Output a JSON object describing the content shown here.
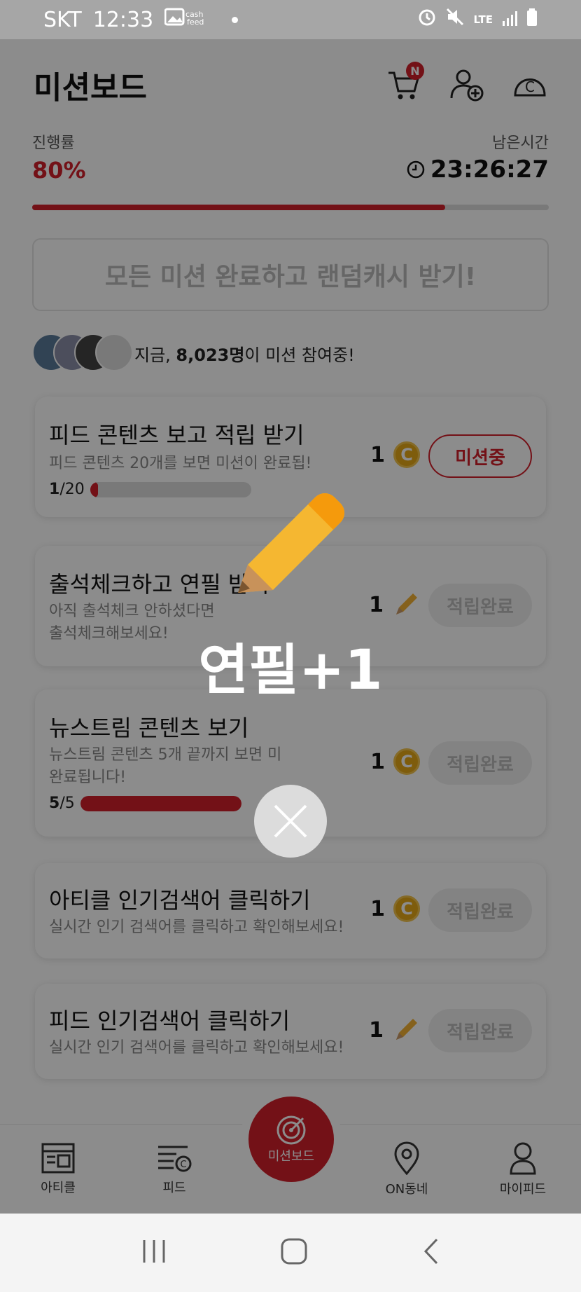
{
  "status_bar": {
    "carrier": "SKT",
    "time": "12:33",
    "network": "LTE"
  },
  "header": {
    "title": "미션보드",
    "cart_badge": "N"
  },
  "progress": {
    "label": "진행률",
    "value_text": "80%",
    "value": 0.8,
    "remaining_label": "남은시간",
    "remaining_time": "23:26:27"
  },
  "all_missions_button": "모든 미션 완료하고 랜덤캐시 받기!",
  "participants": {
    "prefix": "지금, ",
    "count": "8,023명",
    "suffix": "이 미션 참여중!"
  },
  "missions": [
    {
      "title": "피드 콘텐츠 보고 적립 받기",
      "desc": "피드 콘텐츠 20개를 보면 미션이 완료됩!",
      "reward": "1",
      "reward_type": "coin",
      "status": "미션중",
      "progress_current": "1",
      "progress_total": "/20",
      "progress_value": 0.05
    },
    {
      "title": "출석체크하고 연필 받기",
      "desc": "아직 출석체크 안하셨다면",
      "desc2": "출석체크해보세요!",
      "reward": "1",
      "reward_type": "pencil",
      "status": "적립완료"
    },
    {
      "title": "뉴스트림 콘텐츠 보기",
      "desc": "뉴스트림 콘텐츠 5개 끝까지 보면 미",
      "desc2": "완료됩니다!",
      "reward": "1",
      "reward_type": "coin",
      "status": "적립완료",
      "progress_current": "5",
      "progress_total": "/5",
      "progress_value": 1.0
    },
    {
      "title": "아티클 인기검색어 클릭하기",
      "desc": "실시간 인기 검색어를 클릭하고 확인해보세요!",
      "reward": "1",
      "reward_type": "coin",
      "status": "적립완료"
    },
    {
      "title": "피드 인기검색어 클릭하기",
      "desc": "실시간 인기 검색어를 클릭하고 확인해보세요!",
      "reward": "1",
      "reward_type": "pencil",
      "status": "적립완료"
    }
  ],
  "bottom_nav": {
    "article": "아티클",
    "feed": "피드",
    "mission": "미션보드",
    "on_neighborhood": "ON동네",
    "my_feed": "마이피드"
  },
  "overlay": {
    "reward_text": "연필+1"
  },
  "colors": {
    "accent": "#d21f2b",
    "coin": "#e6a817"
  }
}
